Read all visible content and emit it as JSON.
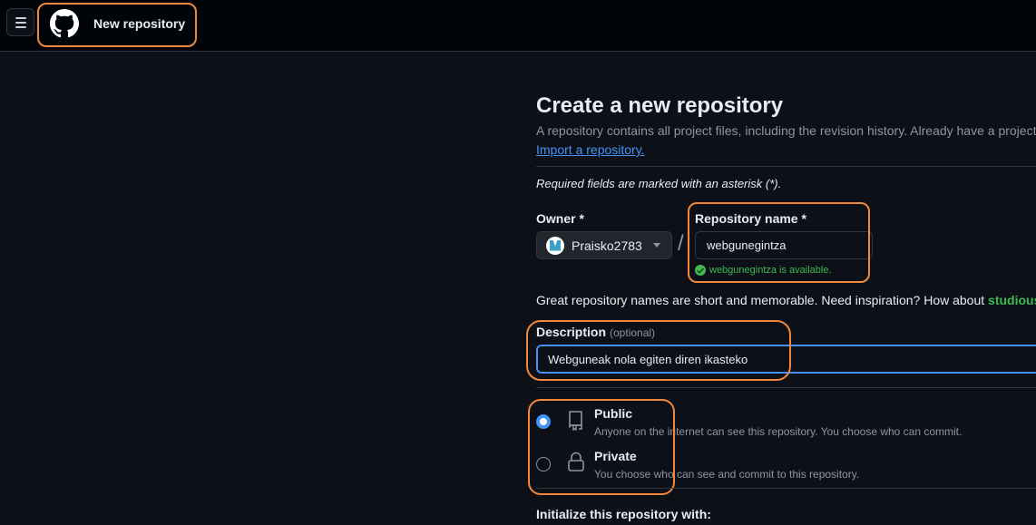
{
  "header": {
    "title": "New repository",
    "menu_icon": "hamburger-icon",
    "logo_icon": "github-logo-icon"
  },
  "page": {
    "title": "Create a new repository",
    "subtitle": "A repository contains all project files, including the revision history. Already have a project",
    "import_link": "Import a repository.",
    "required_note": "Required fields are marked with an asterisk (*)."
  },
  "owner": {
    "label": "Owner *",
    "value": "Praisko2783"
  },
  "repo_name": {
    "label": "Repository name *",
    "value": "webgunegintza",
    "availability": "webgunegintza is available."
  },
  "naming_hint": {
    "text": "Great repository names are short and memorable. Need inspiration? How about ",
    "suggestion": "studious-"
  },
  "description": {
    "label": "Description",
    "optional": "(optional)",
    "value": "Webguneak nola egiten diren ikasteko"
  },
  "visibility": {
    "selected": "public",
    "options": [
      {
        "title": "Public",
        "desc": "Anyone on the internet can see this repository. You choose who can commit.",
        "icon": "repo-icon"
      },
      {
        "title": "Private",
        "desc": "You choose who can see and commit to this repository.",
        "icon": "lock-icon"
      }
    ]
  },
  "initialize": {
    "label": "Initialize this repository with:"
  },
  "colors": {
    "annotation": "#f0883e",
    "accent": "#4493f8",
    "success": "#3fb950"
  }
}
